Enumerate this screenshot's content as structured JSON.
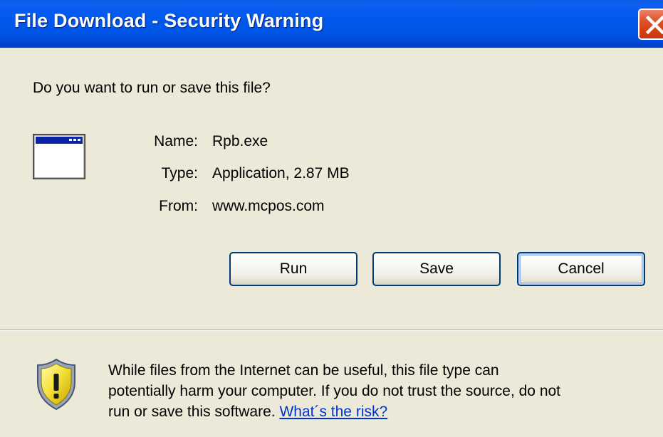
{
  "window": {
    "title": "File Download - Security Warning"
  },
  "prompt": "Do you want to run or save this file?",
  "file": {
    "name_label": "Name:",
    "name_value": "Rpb.exe",
    "type_label": "Type:",
    "type_value": "Application, 2.87 MB",
    "from_label": "From:",
    "from_value": "www.mcpos.com",
    "icon": "application-window-icon"
  },
  "buttons": {
    "run": "Run",
    "save": "Save",
    "cancel": "Cancel"
  },
  "warning": {
    "icon": "security-shield-icon",
    "line1": "While files from the Internet can be useful, this file type can",
    "line2": "potentially harm your computer. If you do not trust the source, do not",
    "line3": "run or save this software.",
    "link": "What´s the risk?"
  },
  "colors": {
    "titlebar": "#0055E5",
    "dialog_background": "#ECE9D8",
    "close_button": "#D63B12",
    "link": "#0033CC"
  }
}
